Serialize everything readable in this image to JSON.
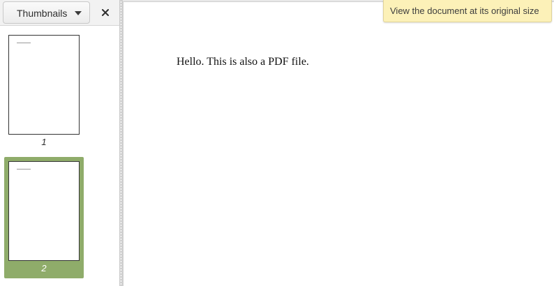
{
  "sidebar": {
    "view_selector": {
      "label": "Thumbnails",
      "arrow_icon": "pan-down-icon"
    },
    "close_icon": "close-icon",
    "thumbnails": [
      {
        "page_number": "1",
        "selected": false
      },
      {
        "page_number": "2",
        "selected": true
      }
    ],
    "selection_color": "#8fac6a"
  },
  "document": {
    "text": "Hello. This is also a PDF file."
  },
  "tooltip": {
    "text": "View the document at its original size"
  }
}
